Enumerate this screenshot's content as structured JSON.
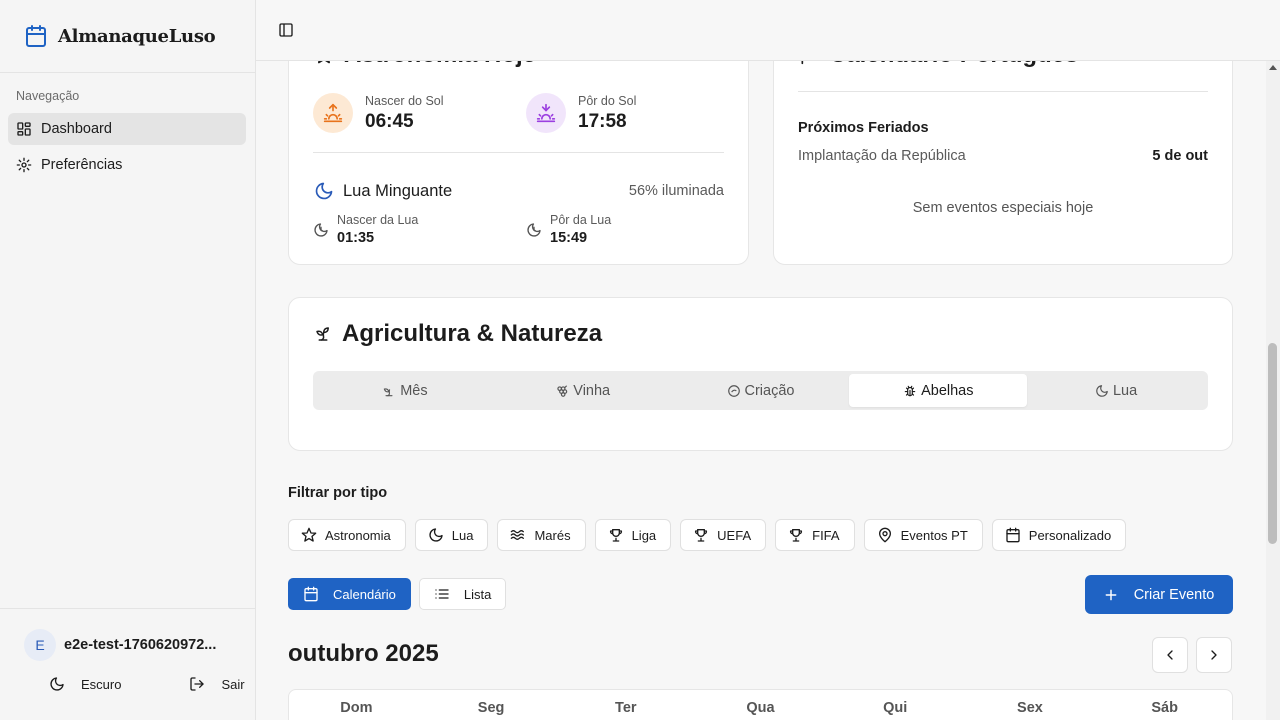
{
  "app": {
    "name": "AlmanaqueLuso"
  },
  "sidebar": {
    "heading": "Navegação",
    "items": [
      {
        "label": "Dashboard",
        "icon": "dashboard-icon",
        "active": true
      },
      {
        "label": "Preferências",
        "icon": "gear-icon",
        "active": false
      }
    ],
    "user": {
      "initial": "E",
      "name": "e2e-test-1760620972..."
    },
    "actions": {
      "theme_label": "Escuro",
      "logout_label": "Sair"
    }
  },
  "astronomy": {
    "title": "Astronomia Hoje",
    "sunrise": {
      "label": "Nascer do Sol",
      "time": "06:45"
    },
    "sunset": {
      "label": "Pôr do Sol",
      "time": "17:58"
    },
    "moon": {
      "phase": "Lua Minguante",
      "illumination": "56% iluminada",
      "rise": {
        "label": "Nascer da Lua",
        "time": "01:35"
      },
      "set": {
        "label": "Pôr da Lua",
        "time": "15:49"
      }
    }
  },
  "calendar_pt": {
    "title": "Calendário Português",
    "next_holidays_title": "Próximos Feriados",
    "holidays": [
      {
        "name": "Implantação da República",
        "date": "5 de out"
      }
    ],
    "no_events": "Sem eventos especiais hoje"
  },
  "agriculture": {
    "title": "Agricultura & Natureza",
    "tabs": [
      {
        "label": "Mês",
        "icon": "sprout-icon",
        "active": false
      },
      {
        "label": "Vinha",
        "icon": "grape-icon",
        "active": false
      },
      {
        "label": "Criação",
        "icon": "egg-icon",
        "active": false
      },
      {
        "label": "Abelhas",
        "icon": "bug-icon",
        "active": true
      },
      {
        "label": "Lua",
        "icon": "moon-icon",
        "active": false
      }
    ]
  },
  "filters": {
    "label": "Filtrar por tipo",
    "chips": [
      {
        "label": "Astronomia",
        "icon": "star-icon"
      },
      {
        "label": "Lua",
        "icon": "moon-icon"
      },
      {
        "label": "Marés",
        "icon": "waves-icon"
      },
      {
        "label": "Liga",
        "icon": "trophy-icon"
      },
      {
        "label": "UEFA",
        "icon": "trophy-icon"
      },
      {
        "label": "FIFA",
        "icon": "trophy-icon"
      },
      {
        "label": "Eventos PT",
        "icon": "map-pin-icon"
      },
      {
        "label": "Personalizado",
        "icon": "calendar-icon"
      }
    ]
  },
  "view": {
    "calendar_label": "Calendário",
    "list_label": "Lista",
    "active": "calendar"
  },
  "create_event_label": "Criar Evento",
  "month": {
    "title": "outubro 2025",
    "weekdays": [
      "Dom",
      "Seg",
      "Ter",
      "Qua",
      "Qui",
      "Sex",
      "Sáb"
    ]
  },
  "colors": {
    "primary": "#1f63c4",
    "sunrise_bg": "#fde9d4",
    "sunrise_icon": "#e8731c",
    "sunset_bg": "#f1e5fb",
    "sunset_icon": "#9b3fe0",
    "moon_icon": "#2a5bb8"
  }
}
